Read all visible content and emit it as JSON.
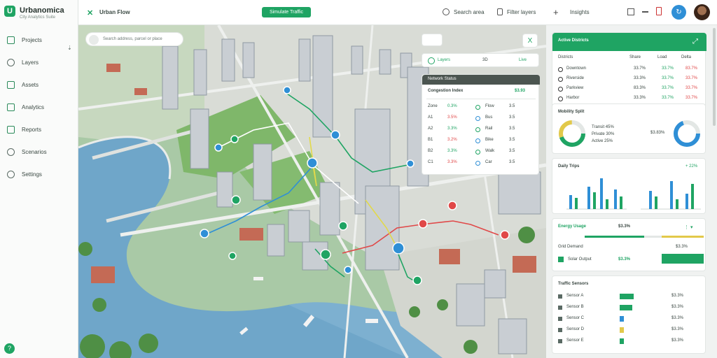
{
  "app": {
    "name": "Urbanomica",
    "subtitle": "City Analytics Suite"
  },
  "colors": {
    "accent": "#1fa463",
    "alert": "#e04848",
    "water": "#6fa6c9",
    "info": "#2f8fd6"
  },
  "sidebar": {
    "items": [
      {
        "label": "Projects",
        "icon": "grid-icon"
      },
      {
        "label": "Layers",
        "icon": "circle-icon"
      },
      {
        "label": "Assets",
        "icon": "folder-icon"
      },
      {
        "label": "Analytics",
        "icon": "chart-icon"
      },
      {
        "label": "Reports",
        "icon": "share-icon"
      },
      {
        "label": "Scenarios",
        "icon": "settings-icon"
      },
      {
        "label": "Settings",
        "icon": "circle-icon"
      }
    ]
  },
  "topbar": {
    "title": "Urban Flow",
    "action": "Simulate Traffic",
    "search": "Search area",
    "filter": "Filter layers"
  },
  "topright": {
    "label": "Insights"
  },
  "map": {
    "search_placeholder": "Search address, parcel or place",
    "close_label": "X",
    "tabs": [
      "Layers",
      "3D",
      "Live"
    ],
    "mini_header": "Network Status",
    "mini_title": "Congestion Index",
    "mini_value": "$3.93",
    "mini_rows": [
      {
        "a": "Zone",
        "b": "0.3%",
        "c": "Flow",
        "d": "3.5"
      },
      {
        "a": "A1",
        "b": "3.5%",
        "c": "Bus",
        "d": "3.5"
      },
      {
        "a": "A2",
        "b": "3.3%",
        "c": "Rail",
        "d": "3.5"
      },
      {
        "a": "B1",
        "b": "3.2%",
        "c": "Bike",
        "d": "3.5"
      },
      {
        "a": "B2",
        "b": "3.3%",
        "c": "Walk",
        "d": "3.5"
      },
      {
        "a": "C1",
        "b": "3.3%",
        "c": "Car",
        "d": "3.5"
      }
    ]
  },
  "right": {
    "card1": {
      "title": "Active Districts",
      "rows": [
        {
          "label": "Downtown",
          "v1": "33.7%",
          "v2": "33.7%",
          "v3": "83.7%"
        },
        {
          "label": "Riverside",
          "v1": "33.3%",
          "v2": "33.7%",
          "v3": "33.7%"
        },
        {
          "label": "Parkview",
          "v1": "83.3%",
          "v2": "33.7%",
          "v3": "33.7%"
        },
        {
          "label": "Harbor",
          "v1": "33.3%",
          "v2": "33.7%",
          "v3": "33.7%"
        }
      ],
      "cols": [
        "Districts",
        "Share",
        "Load",
        "Delta"
      ]
    },
    "donuts": {
      "title": "Mobility Split",
      "legend": [
        "Transit 45%",
        "Private 30%",
        "Active 25%"
      ],
      "value": "$3.83%"
    },
    "bars": {
      "title": "Daily Trips",
      "label": "+ 22%"
    },
    "kpi": {
      "title": "Energy Usage",
      "value": "$3.3%",
      "rows": [
        {
          "label": "Grid Demand",
          "value": "$3.3%"
        },
        {
          "label": "Solar Output",
          "value": "$3.3%"
        }
      ]
    },
    "table": {
      "title": "Traffic Sensors",
      "rows": [
        {
          "label": "Sensor A",
          "value": "$3.3%"
        },
        {
          "label": "Sensor B",
          "value": "$3.3%"
        },
        {
          "label": "Sensor C",
          "value": "$3.3%"
        },
        {
          "label": "Sensor D",
          "value": "$3.3%"
        },
        {
          "label": "Sensor E",
          "value": "$3.3%"
        }
      ]
    }
  }
}
